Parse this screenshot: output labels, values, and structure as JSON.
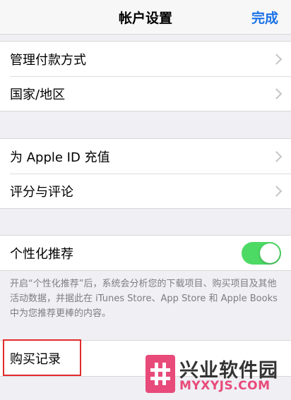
{
  "header": {
    "title": "帐户设置",
    "done_label": "完成"
  },
  "groups": [
    {
      "items": [
        {
          "label": "管理付款方式"
        },
        {
          "label": "国家/地区"
        }
      ]
    },
    {
      "items": [
        {
          "label": "为 Apple ID 充值"
        },
        {
          "label": "评分与评论"
        }
      ]
    },
    {
      "items": [
        {
          "label": "个性化推荐",
          "toggle": true
        }
      ]
    }
  ],
  "personalization": {
    "footnote": "开启“个性化推荐”后，系统会分析您的下载项目、购买项目及其他活动数据，并据此在 iTunes Store、App Store 和 Apple Books 中为您推荐更棒的内容。"
  },
  "purchase_history": {
    "label": "购买记录"
  },
  "watermark": {
    "name": "兴业软件园",
    "url": "MYXYJS.COM"
  },
  "colors": {
    "accent": "#1a73e8",
    "toggle_on": "#4cd964",
    "highlight": "#e22b2b",
    "watermark": "#e84a7a"
  }
}
